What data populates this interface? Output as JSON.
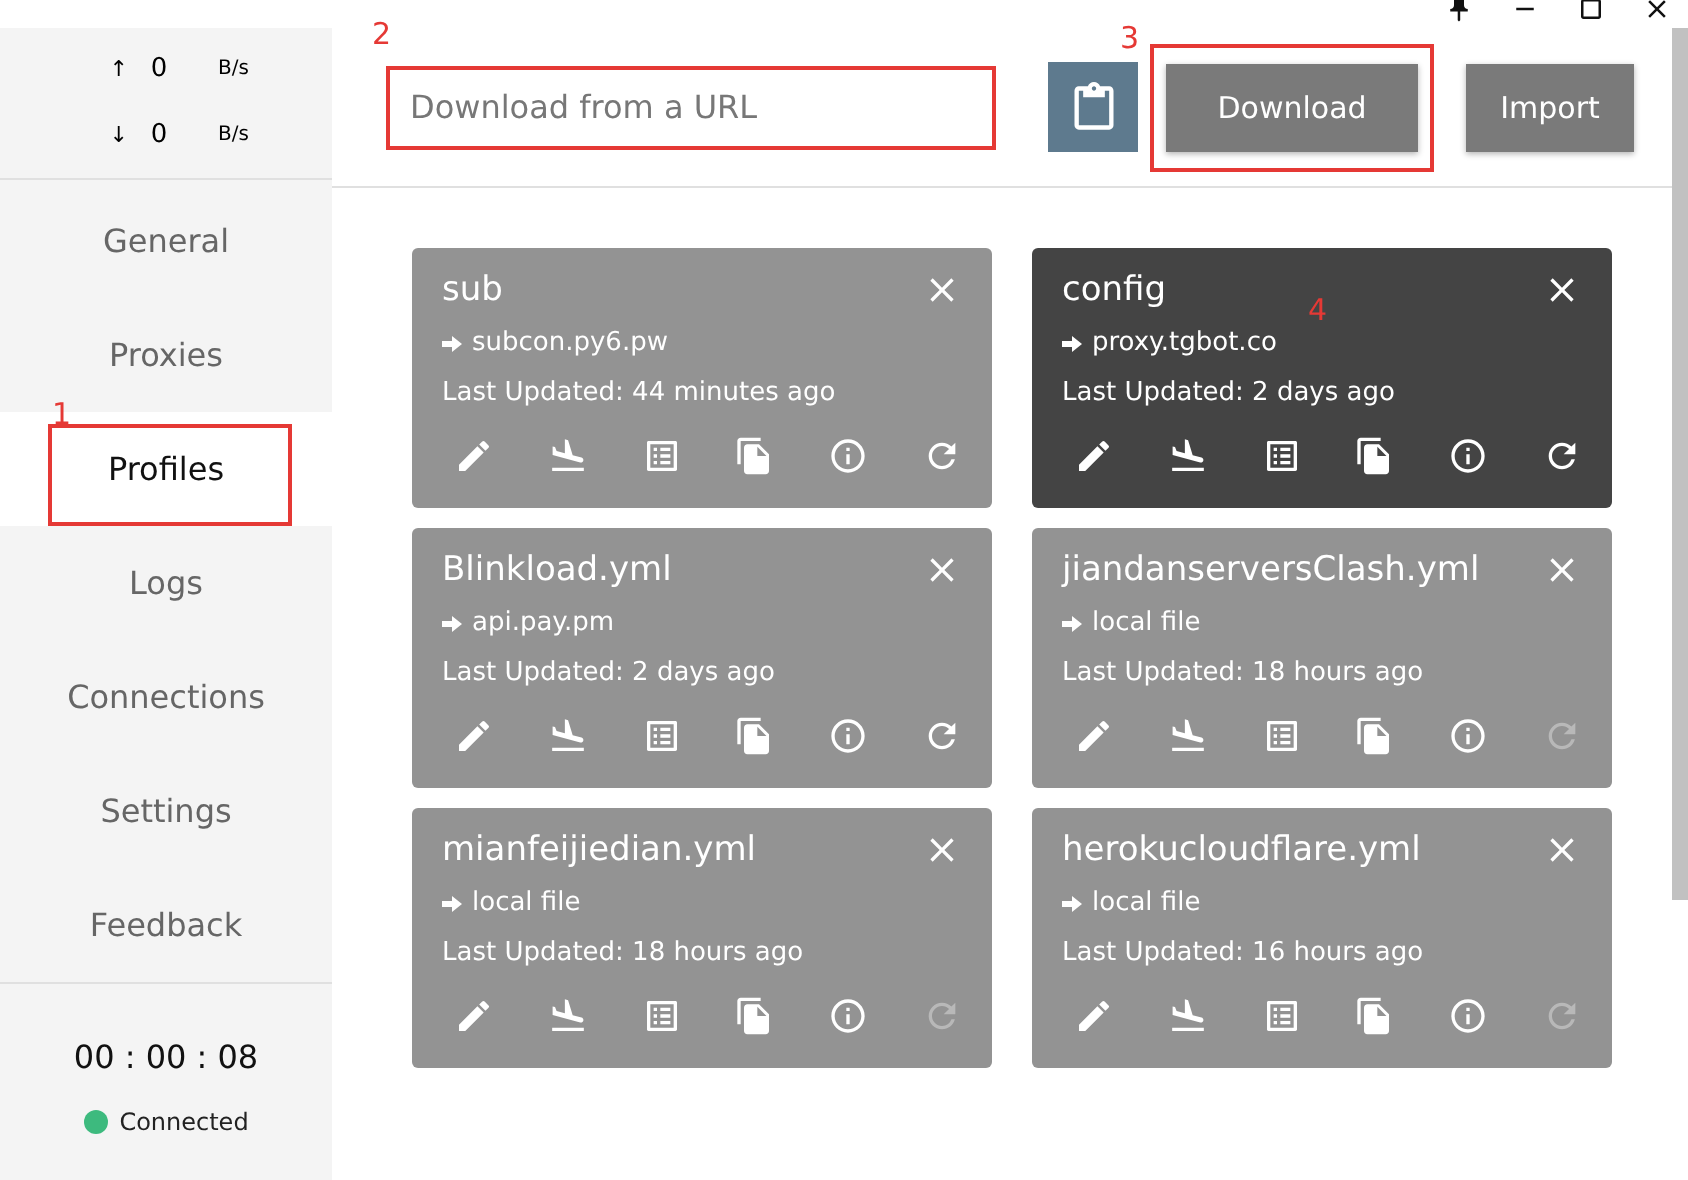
{
  "traffic": [
    {
      "arrow": "↑",
      "value": "0",
      "unit": "B/s"
    },
    {
      "arrow": "↓",
      "value": "0",
      "unit": "B/s"
    }
  ],
  "nav": [
    {
      "label": "General",
      "selected": false,
      "highlighted": false
    },
    {
      "label": "Proxies",
      "selected": false,
      "highlighted": false
    },
    {
      "label": "Profiles",
      "selected": true,
      "highlighted": true
    },
    {
      "label": "Logs",
      "selected": false,
      "highlighted": false
    },
    {
      "label": "Connections",
      "selected": false,
      "highlighted": false
    },
    {
      "label": "Settings",
      "selected": false,
      "highlighted": false
    },
    {
      "label": "Feedback",
      "selected": false,
      "highlighted": false
    }
  ],
  "timer": "00 : 00 : 08",
  "status": {
    "label": "Connected",
    "color": "#3dba7e"
  },
  "url_field": {
    "placeholder": "Download from a URL",
    "highlighted": true
  },
  "buttons": [
    {
      "label": "Download",
      "highlighted": true
    },
    {
      "label": "Import",
      "highlighted": false
    }
  ],
  "profiles": [
    {
      "name": "sub",
      "source": "subcon.py6.pw",
      "updated": "Last Updated: 44 minutes ago",
      "selected": false,
      "refresh_disabled": false
    },
    {
      "name": "config",
      "source": "proxy.tgbot.co",
      "updated": "Last Updated: 2 days ago",
      "selected": true,
      "refresh_disabled": false
    },
    {
      "name": "Blinkload.yml",
      "source": "api.pay.pm",
      "updated": "Last Updated: 2 days ago",
      "selected": false,
      "refresh_disabled": false
    },
    {
      "name": "jiandanserversClash.yml",
      "source": "local file",
      "updated": "Last Updated: 18 hours ago",
      "selected": false,
      "refresh_disabled": true
    },
    {
      "name": "mianfeijiedian.yml",
      "source": "local file",
      "updated": "Last Updated: 18 hours ago",
      "selected": false,
      "refresh_disabled": true
    },
    {
      "name": "herokucloudflare.yml",
      "source": "local file",
      "updated": "Last Updated: 16 hours ago",
      "selected": false,
      "refresh_disabled": true
    }
  ],
  "annotations": [
    "1",
    "2",
    "3",
    "4"
  ]
}
